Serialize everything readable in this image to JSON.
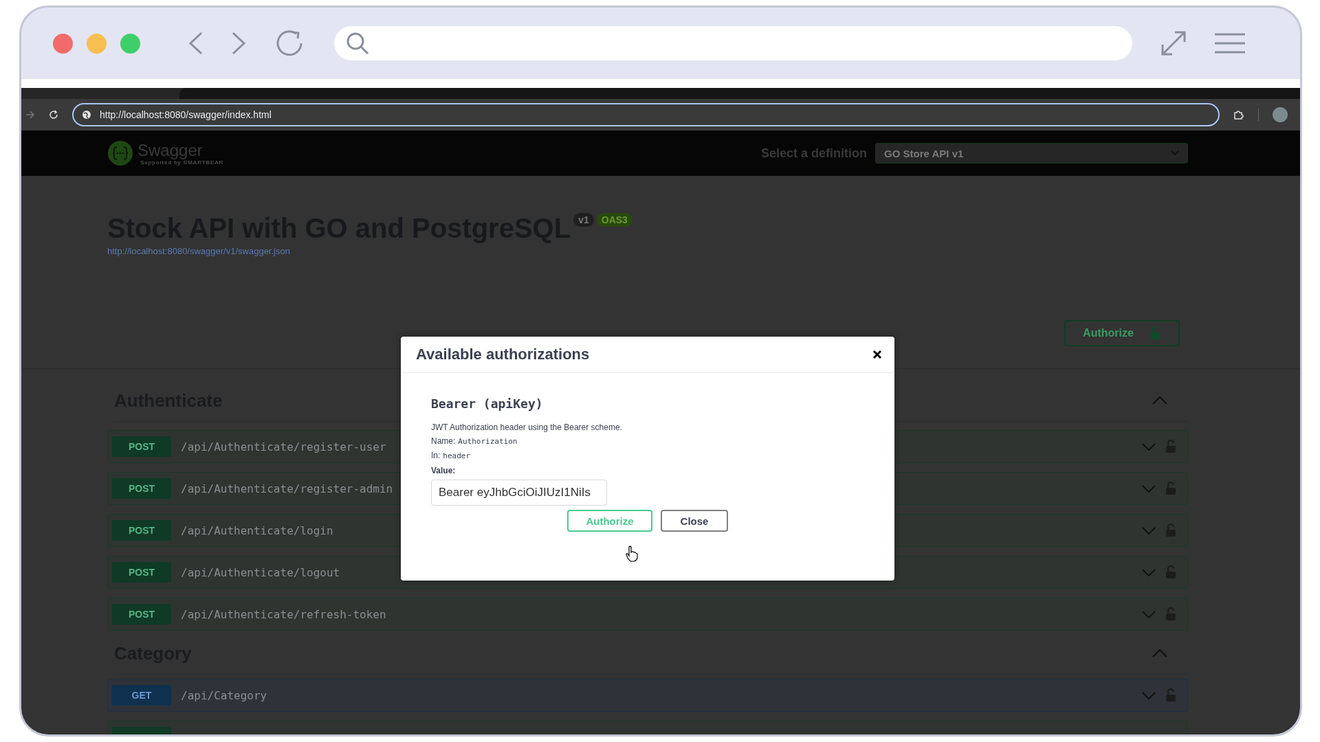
{
  "browser": {
    "address": "http://localhost:8080/swagger/index.html"
  },
  "header": {
    "brand": "Swagger",
    "tagline": "Supported by SMARTBEAR",
    "definition_label": "Select a definition",
    "definition": "GO Store API v1"
  },
  "info": {
    "title": "Stock API with GO and PostgreSQL",
    "version": "v1",
    "spec": "OAS3",
    "url": "http://localhost:8080/swagger/v1/swagger.json"
  },
  "authorize_button": "Authorize",
  "sections": [
    {
      "name": "Authenticate",
      "expanded": true,
      "operations": [
        {
          "kind": "post",
          "method": "POST",
          "path": "/api/Authenticate/register-user",
          "expanded": false
        },
        {
          "kind": "post",
          "method": "POST",
          "path": "/api/Authenticate/register-admin",
          "expanded": false
        },
        {
          "kind": "post",
          "method": "POST",
          "path": "/api/Authenticate/login",
          "expanded": false
        },
        {
          "kind": "post",
          "method": "POST",
          "path": "/api/Authenticate/logout",
          "expanded": false
        },
        {
          "kind": "post",
          "method": "POST",
          "path": "/api/Authenticate/refresh-token",
          "expanded": false
        }
      ]
    },
    {
      "name": "Category",
      "expanded": true,
      "operations": [
        {
          "kind": "get",
          "method": "GET",
          "path": "/api/Category",
          "expanded": false
        },
        {
          "kind": "post"
        }
      ]
    }
  ],
  "modal": {
    "title": "Available authorizations",
    "scheme": "Bearer (apiKey)",
    "description": "JWT Authorization header using the Bearer scheme.",
    "name_label": "Name:",
    "name": "Authorization",
    "in_label": "In:",
    "in": "header",
    "value_label": "Value:",
    "value": "Bearer eyJhbGciOiJIUzI1NiIs",
    "buttons": [
      {
        "kind": "primary",
        "label": "Authorize"
      },
      {
        "kind": "secondary",
        "label": "Close"
      }
    ]
  }
}
